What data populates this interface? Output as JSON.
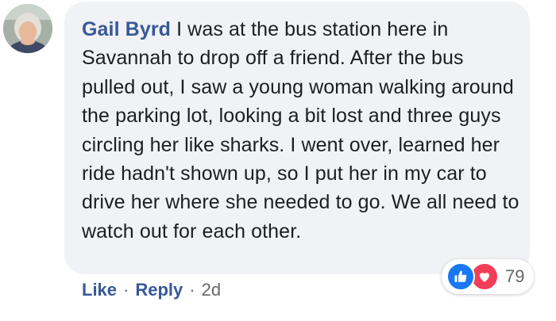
{
  "comment": {
    "author": "Gail Byrd",
    "text": "I was at the bus station here in Savannah to drop off a friend. After the bus pulled out, I saw a young woman walking around the parking lot, looking a bit lost and three guys circling her like sharks. I went over, learned her ride hadn't shown up, so I put her in my car to drive her where she needed to go. We all need to watch out for each other."
  },
  "reactions": {
    "icons": [
      "like-icon",
      "heart-icon"
    ],
    "count": "79",
    "colors": {
      "like": "#1877f2",
      "love": "#f33e58"
    }
  },
  "actions": {
    "like_label": "Like",
    "reply_label": "Reply",
    "separator": "·",
    "time": "2d"
  },
  "colors": {
    "author": "#385898",
    "bubble": "#f1f2f5",
    "meta": "#65676b"
  }
}
